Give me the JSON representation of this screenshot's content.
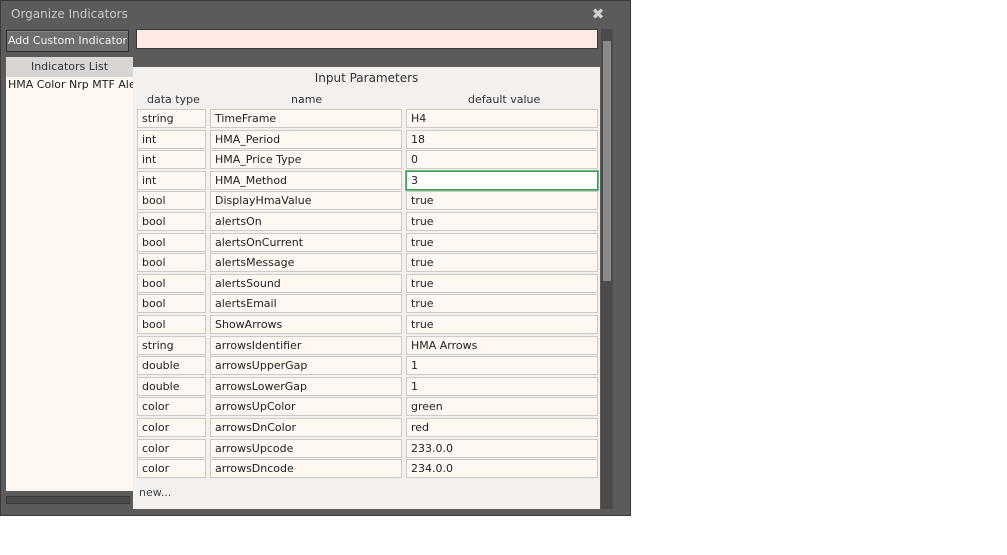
{
  "window": {
    "title": "Organize Indicators"
  },
  "toolbar": {
    "add_label": "Add Custom Indicator"
  },
  "indicators": {
    "header": "Indicators List",
    "items": [
      "HMA Color Nrp MTF Alerts"
    ]
  },
  "params": {
    "title": "Input Parameters",
    "columns": {
      "type": "data type",
      "name": "name",
      "value": "default value"
    },
    "rows": [
      {
        "type": "string",
        "name": "TimeFrame",
        "value": "H4"
      },
      {
        "type": "int",
        "name": "HMA_Period",
        "value": "18"
      },
      {
        "type": "int",
        "name": "HMA_Price Type",
        "value": "0"
      },
      {
        "type": "int",
        "name": "HMA_Method",
        "value": "3"
      },
      {
        "type": "bool",
        "name": "DisplayHmaValue",
        "value": "true"
      },
      {
        "type": "bool",
        "name": "alertsOn",
        "value": "true"
      },
      {
        "type": "bool",
        "name": "alertsOnCurrent",
        "value": "true"
      },
      {
        "type": "bool",
        "name": "alertsMessage",
        "value": "true"
      },
      {
        "type": "bool",
        "name": "alertsSound",
        "value": "true"
      },
      {
        "type": "bool",
        "name": "alertsEmail",
        "value": "true"
      },
      {
        "type": "bool",
        "name": "ShowArrows",
        "value": "true"
      },
      {
        "type": "string",
        "name": "arrowsIdentifier",
        "value": "HMA Arrows"
      },
      {
        "type": "double",
        "name": "arrowsUpperGap",
        "value": "1"
      },
      {
        "type": "double",
        "name": "arrowsLowerGap",
        "value": "1"
      },
      {
        "type": "color",
        "name": "arrowsUpColor",
        "value": "green"
      },
      {
        "type": "color",
        "name": "arrowsDnColor",
        "value": "red"
      },
      {
        "type": "color",
        "name": "arrowsUpcode",
        "value": "233.0.0"
      },
      {
        "type": "color",
        "name": "arrowsDncode",
        "value": "234.0.0"
      }
    ],
    "new_label": "new..."
  }
}
